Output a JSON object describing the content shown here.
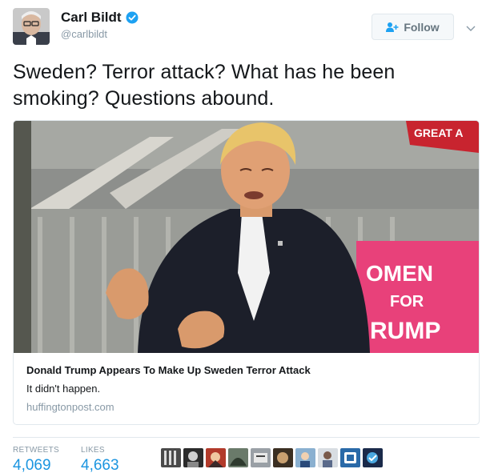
{
  "user": {
    "display_name": "Carl Bildt",
    "handle": "@carlbildt",
    "verified_icon": "verified-badge-icon",
    "avatar_icon": "avatar"
  },
  "follow_button": {
    "label": "Follow",
    "icon": "add-user-icon"
  },
  "tweet": {
    "text": "Sweden? Terror attack? What has he been smoking? Questions abound."
  },
  "card": {
    "image_banner_top": "GREAT A",
    "image_banner_bottom_1": "OMEN",
    "image_banner_bottom_2": "FOR",
    "image_banner_bottom_3": "RUMP",
    "title": "Donald Trump Appears To Make Up Sweden Terror Attack",
    "description": "It didn't happen.",
    "domain": "huffingtonpost.com"
  },
  "stats": {
    "retweets_label": "RETWEETS",
    "retweets_count": "4,069",
    "likes_label": "LIKES",
    "likes_count": "4,663"
  },
  "likers": [
    "liker-1",
    "liker-2",
    "liker-3",
    "liker-4",
    "liker-5",
    "liker-6",
    "liker-7",
    "liker-8",
    "liker-9",
    "liker-10"
  ],
  "colors": {
    "link_blue": "#1b95e0",
    "verified_blue": "#1da1f2",
    "secondary_gray": "#8899a6",
    "banner_pink": "#e8417a"
  }
}
